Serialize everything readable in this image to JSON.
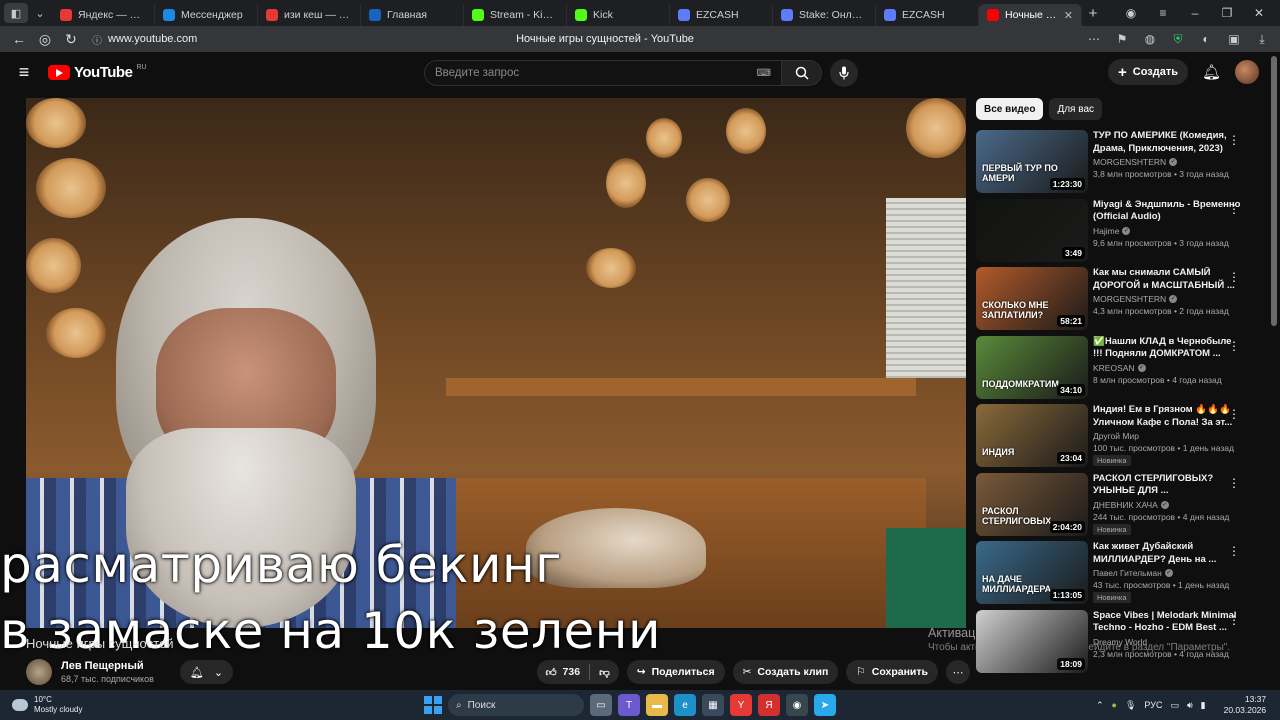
{
  "browser": {
    "tabs": [
      {
        "label": "Яндекс — быстрый",
        "color": "#e53935"
      },
      {
        "label": "Мессенджер",
        "color": "#1e88e5"
      },
      {
        "label": "изи кеш — Яндекс",
        "color": "#e53935"
      },
      {
        "label": "Главная",
        "color": "#1565c0"
      },
      {
        "label": "Stream - Kick Dash",
        "color": "#53fc18"
      },
      {
        "label": "Kick",
        "color": "#53fc18"
      },
      {
        "label": "EZCASH",
        "color": "#5c7cfa"
      },
      {
        "label": "Stake: Онлайн-ка",
        "color": "#5c7cfa"
      },
      {
        "label": "EZCASH",
        "color": "#5c7cfa"
      },
      {
        "label": "Ночные игры",
        "color": "#ff0000",
        "active": true
      }
    ],
    "url": "www.youtube.com",
    "page_title": "Ночные игры сущностей - YouTube"
  },
  "header": {
    "logo_text": "YouTube",
    "logo_region": "RU",
    "search_placeholder": "Введите запрос",
    "create_label": "Создать"
  },
  "video": {
    "overlay_line1": "расматриваю бекинг",
    "overlay_line2": "в замаске  на 10к зелени",
    "title_partial": "Ночные игры сущностей",
    "windows_activation_title": "Активация Windows",
    "windows_activation_sub": "Чтобы активировать Windows, перейдите в раздел \"Параметры\"."
  },
  "channel": {
    "name": "Лев Пещерный",
    "subscribers": "68,7 тыс. подписчиков",
    "likes": "736",
    "share_label": "Поделиться",
    "clip_label": "Создать клип",
    "save_label": "Сохранить"
  },
  "sidebar": {
    "chips": [
      "Все видео",
      "Для вас"
    ],
    "items": [
      {
        "title": "ТУР ПО АМЕРИКЕ (Комедия, Драма, Приключения, 2023)",
        "channel": "MORGENSHTERN",
        "verified": true,
        "stats": "3,8 млн просмотров • 3 года назад",
        "duration": "1:23:30",
        "caption": "ПЕРВЫЙ ТУР ПО АМЕРИ",
        "bg": "#4a6a8a",
        "badge": ""
      },
      {
        "title": "Miyagi & Эндшпиль - Временно (Official Audio)",
        "channel": "Hajime",
        "verified": true,
        "stats": "9,6 млн просмотров • 3 года назад",
        "duration": "3:49",
        "caption": "",
        "bg": "#121410",
        "badge": ""
      },
      {
        "title": "Как мы снимали САМЫЙ ДОРОГОЙ и МАСШТАБНЫЙ ...",
        "channel": "MORGENSHTERN",
        "verified": true,
        "stats": "4,3 млн просмотров • 2 года назад",
        "duration": "58:21",
        "caption": "СКОЛЬКО МНЕ ЗАПЛАТИЛИ?",
        "bg": "#b25a2a",
        "badge": ""
      },
      {
        "title": "✅Нашли КЛАД в Чернобыле !!! Подняли ДОМКРАТОМ ...",
        "channel": "KREOSAN",
        "verified": true,
        "stats": "8 млн просмотров • 4 года назад",
        "duration": "34:10",
        "caption": "Поддомкратим",
        "bg": "#5a8a3a",
        "badge": ""
      },
      {
        "title": "Индия! Ем в Грязном 🔥🔥🔥 Уличном Кафе с Пола! За эт...",
        "channel": "Другой Мир",
        "verified": false,
        "stats": "100 тыс. просмотров • 1 день назад",
        "duration": "23:04",
        "caption": "Индия",
        "bg": "#8a6a3a",
        "badge": "Новинка"
      },
      {
        "title": "РАСКОЛ СТЕРЛИГОВЫХ? УНЫНЬЕ ДЛЯ ...",
        "channel": "ДНЕВНИК ХАЧА",
        "verified": true,
        "stats": "244 тыс. просмотров • 4 дня назад",
        "duration": "2:04:20",
        "caption": "РАСКОЛ СТЕРЛИГОВЫХ",
        "bg": "#7a5a3a",
        "badge": "Новинка"
      },
      {
        "title": "Как живет Дубайский МИЛЛИАРДЕР? День на ...",
        "channel": "Павел Гительман",
        "verified": true,
        "stats": "43 тыс. просмотров • 1 день назад",
        "duration": "1:13:05",
        "caption": "НА ДАЧЕ МИЛЛИАРДЕРА",
        "bg": "#3a6a8a",
        "badge": "Новинка"
      },
      {
        "title": "Space Vibes | Melodark Minimal Techno - Hozho - EDM Best ...",
        "channel": "Dreamy World",
        "verified": false,
        "stats": "2,3 млн просмотров • 4 года назад",
        "duration": "18:09",
        "caption": "",
        "bg": "#d0d0d0",
        "badge": ""
      }
    ]
  },
  "taskbar": {
    "weather_temp": "10°C",
    "weather_desc": "Mostly cloudy",
    "search_label": "Поиск",
    "lang": "РУС",
    "time": "13:37",
    "date": "20.03.2026"
  },
  "icons": {
    "menu": "hamburger-icon",
    "search": "search-icon",
    "mic": "mic-icon",
    "bell": "bell-icon",
    "like": "thumbs-up-icon",
    "dislike": "thumbs-down-icon"
  }
}
